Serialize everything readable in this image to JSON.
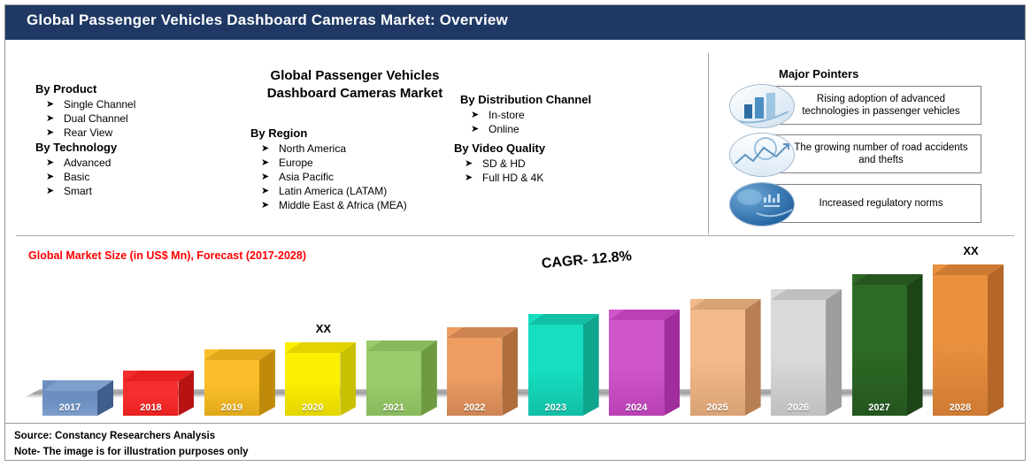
{
  "header": {
    "title": "Global Passenger Vehicles Dashboard Cameras Market: Overview"
  },
  "center": {
    "title_line1": "Global Passenger Vehicles",
    "title_line2": "Dashboard Cameras Market"
  },
  "segments": [
    {
      "id": "by-product",
      "heading": "By Product",
      "items": [
        "Single Channel",
        "Dual Channel",
        "Rear View"
      ]
    },
    {
      "id": "by-technology",
      "heading": "By Technology",
      "items": [
        "Advanced",
        "Basic",
        "Smart"
      ]
    },
    {
      "id": "by-region",
      "heading": "By Region",
      "items": [
        "North America",
        "Europe",
        "Asia Pacific",
        "Latin America (LATAM)",
        "Middle East & Africa (MEA)"
      ]
    },
    {
      "id": "by-distribution-channel",
      "heading": "By Distribution Channel",
      "items": [
        "In-store",
        "Online"
      ]
    },
    {
      "id": "by-video-quality",
      "heading": "By Video Quality",
      "items": [
        "SD & HD",
        "Full HD & 4K"
      ]
    }
  ],
  "bullet_glyph": "➤",
  "major_pointers": {
    "title": "Major Pointers",
    "items": [
      {
        "icon": "bar-chart-icon",
        "text": "Rising adoption of advanced technologies in passenger vehicles"
      },
      {
        "icon": "line-graph-icon",
        "text": "The growing number of road accidents and thefts"
      },
      {
        "icon": "globe-regulation-icon",
        "text": "Increased regulatory norms"
      }
    ]
  },
  "chart_data": {
    "type": "bar",
    "title": "Global Market Size (in US$ Mn), Forecast (2017-2028)",
    "title_color": "#FF0000",
    "annotation": "CAGR- 12.8%",
    "xlabel": "",
    "ylabel": "",
    "grid": false,
    "legend": "none",
    "categories": [
      "2017",
      "2018",
      "2019",
      "2020",
      "2021",
      "2022",
      "2023",
      "2024",
      "2025",
      "2026",
      "2027",
      "2028"
    ],
    "values": [
      18,
      26,
      44,
      50,
      52,
      63,
      74,
      78,
      87,
      95,
      108,
      116
    ],
    "ylim": [
      0,
      130
    ],
    "value_labels": [
      "",
      "",
      "",
      "XX",
      "",
      "",
      "",
      "",
      "",
      "",
      "",
      "XX"
    ],
    "bar_colors": [
      "#6B8FC0",
      "#F62E2E",
      "#FBBE2B",
      "#FBF000",
      "#9BCB6A",
      "#EE9D63",
      "#16DEC0",
      "#CE56C9",
      "#F2B98A",
      "#D9D9D9",
      "#2D6A25",
      "#E8903E"
    ],
    "bar_side_colors": [
      "#3F5E8C",
      "#B81212",
      "#C08B0A",
      "#C9C000",
      "#6E9B42",
      "#B06E3C",
      "#0FA58D",
      "#A02D9C",
      "#B97F54",
      "#9E9E9E",
      "#1C4417",
      "#B5672A"
    ],
    "bar_top_colors": [
      "#7E9ECB",
      "#E82020",
      "#E0A81A",
      "#E3D400",
      "#88B95C",
      "#CE8553",
      "#12BFA6",
      "#B941B4",
      "#D9A274",
      "#BFBFBF",
      "#24561E",
      "#CE7A33"
    ]
  },
  "footer": {
    "source": "Source: Constancy Researchers Analysis",
    "note": "Note- The image is for illustration purposes only"
  }
}
